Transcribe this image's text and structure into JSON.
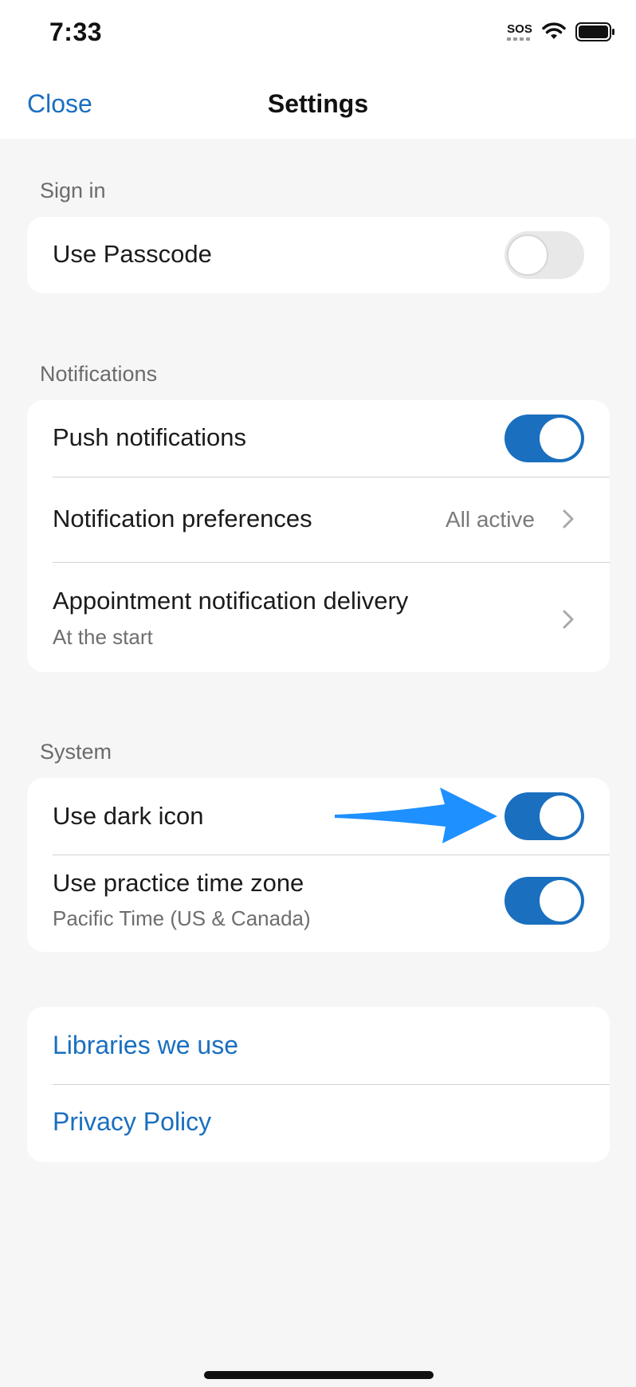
{
  "status_bar": {
    "time": "7:33",
    "sos_label": "SOS",
    "icons": [
      "sos-indicator",
      "wifi-icon",
      "battery-icon"
    ]
  },
  "nav": {
    "close_label": "Close",
    "title": "Settings"
  },
  "sections": {
    "sign_in": {
      "header": "Sign in",
      "use_passcode": {
        "label": "Use Passcode",
        "enabled": false
      }
    },
    "notifications": {
      "header": "Notifications",
      "push": {
        "label": "Push notifications",
        "enabled": true
      },
      "preferences": {
        "label": "Notification preferences",
        "value": "All active"
      },
      "appointment_delivery": {
        "label": "Appointment notification delivery",
        "subtitle": "At the start"
      }
    },
    "system": {
      "header": "System",
      "dark_icon": {
        "label": "Use dark icon",
        "enabled": true
      },
      "practice_tz": {
        "label": "Use practice time zone",
        "subtitle": "Pacific Time (US & Canada)",
        "enabled": true
      }
    },
    "links": {
      "libraries": "Libraries we use",
      "privacy": "Privacy Policy"
    }
  },
  "colors": {
    "accent": "#1a6fbf",
    "annotation_arrow": "#1e90ff",
    "background": "#f6f6f6",
    "card": "#ffffff",
    "secondary_text": "#6e6e6e"
  }
}
